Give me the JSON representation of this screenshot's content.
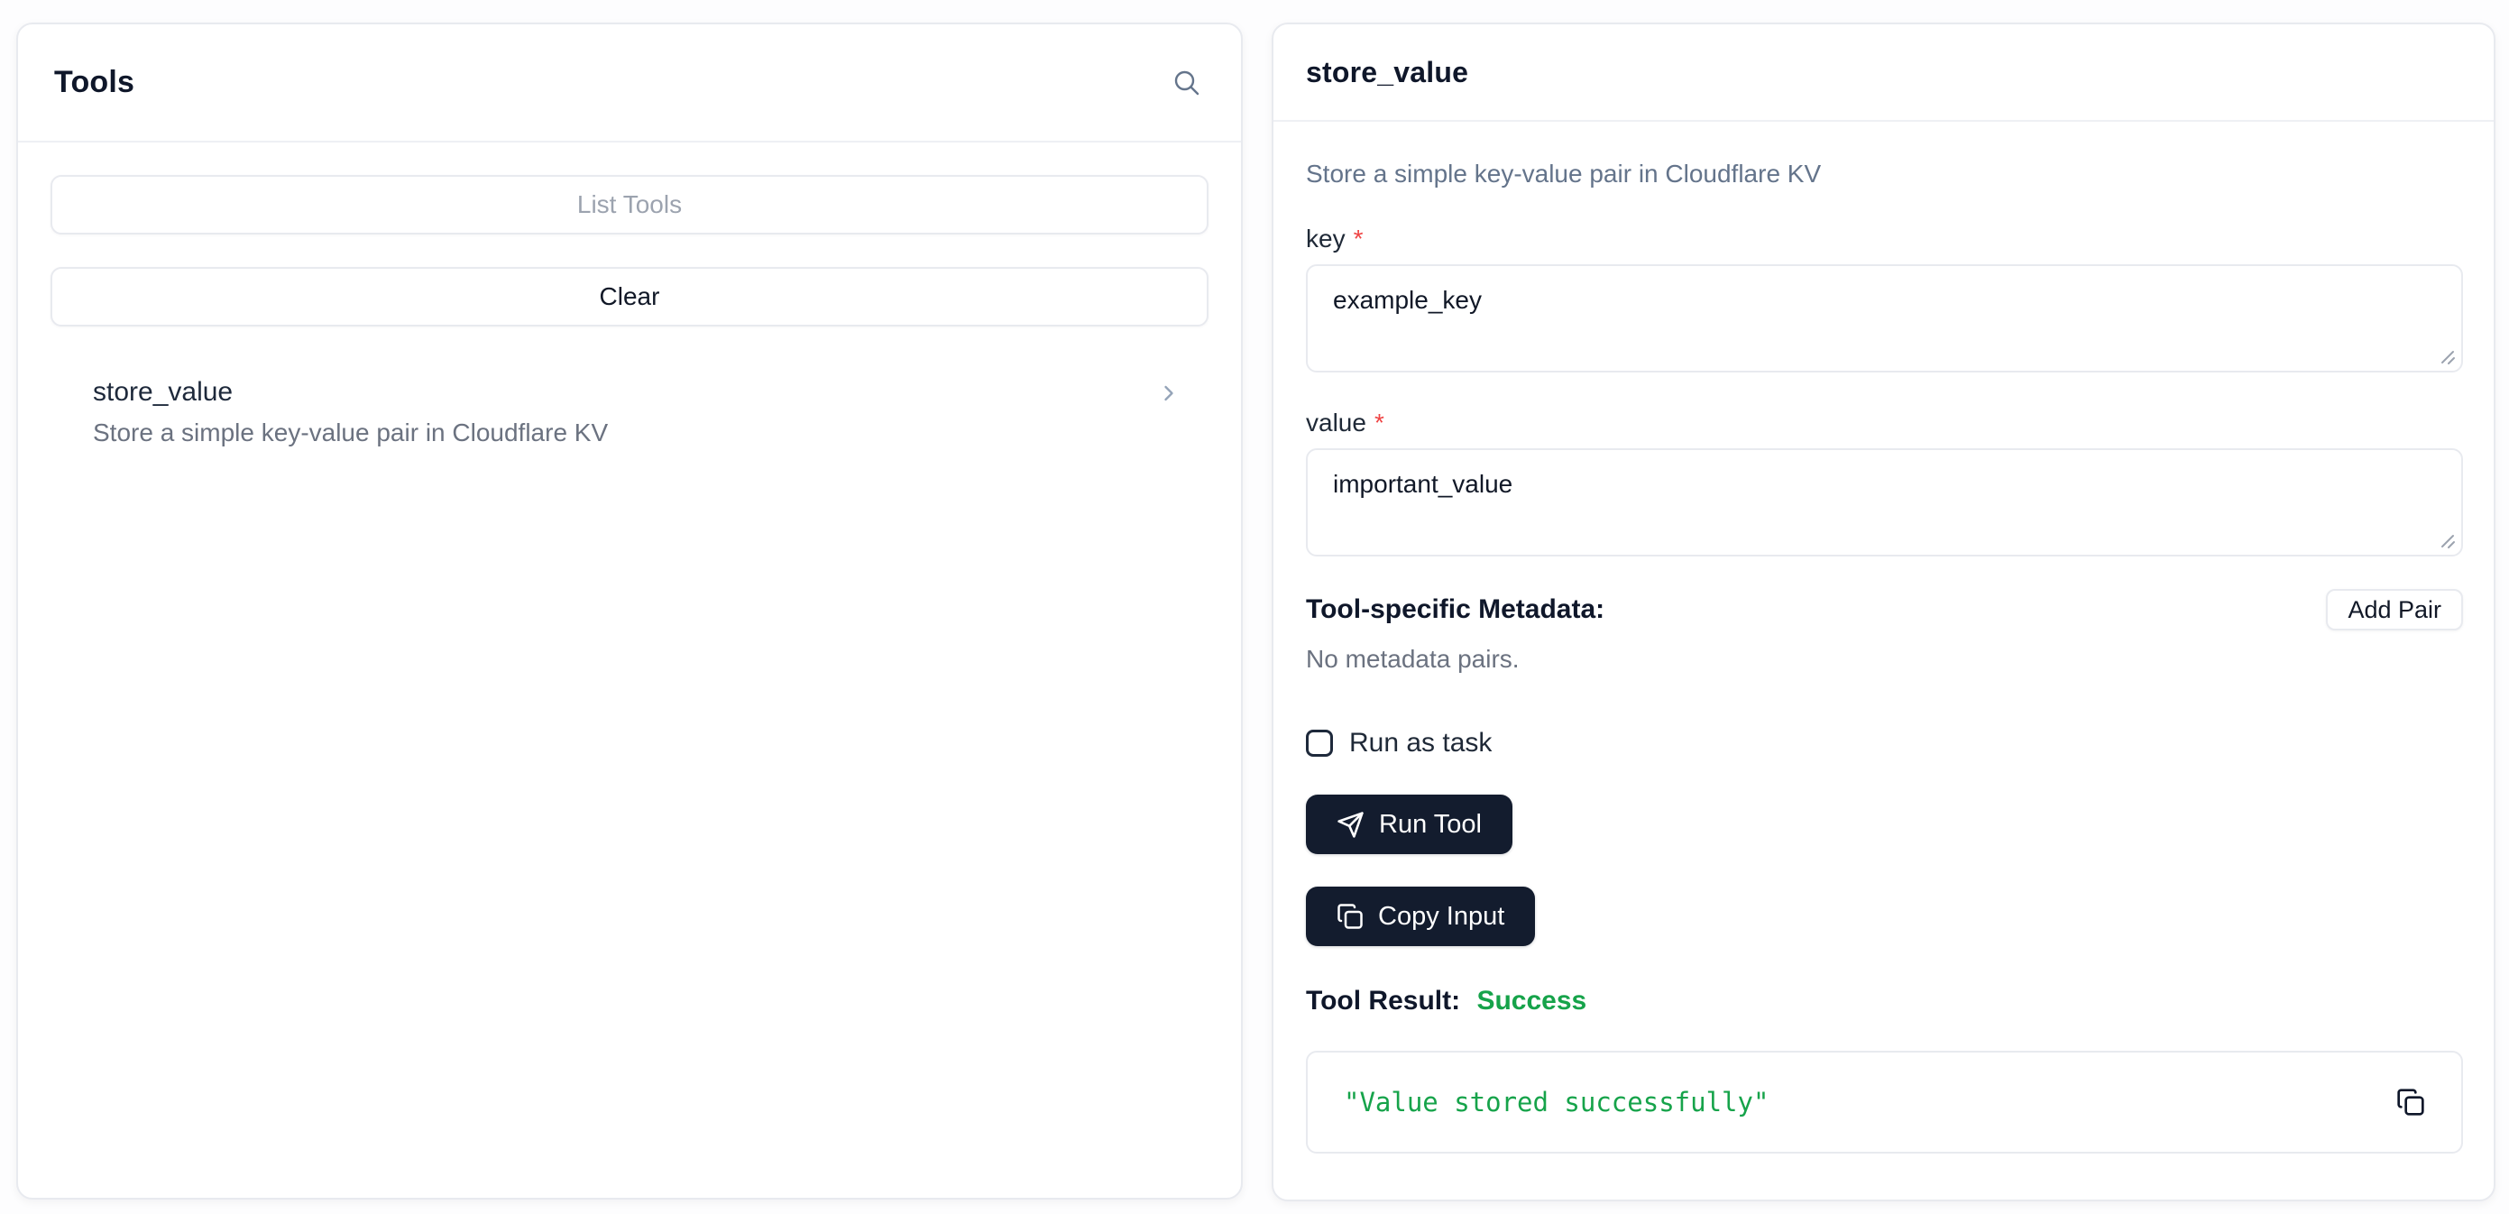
{
  "colors": {
    "accent_dark": "#131c2e",
    "success_green": "#16a34a",
    "required_red": "#ef4444",
    "panel_border": "#e8eaef",
    "muted_text": "#6b7280"
  },
  "icons": {
    "search": "magnifying-glass",
    "chevron_right": "angle-bracket-right",
    "send": "paper-plane",
    "copy": "overlapping-squares",
    "resize_grip": "diagonal-lines"
  },
  "tools_panel": {
    "title": "Tools",
    "list_tools_button": "List Tools",
    "clear_button": "Clear",
    "tools": [
      {
        "name": "store_value",
        "description": "Store a simple key-value pair in Cloudflare KV"
      }
    ]
  },
  "detail_panel": {
    "title": "store_value",
    "description": "Store a simple key-value pair in Cloudflare KV",
    "fields": [
      {
        "label": "key",
        "required_marker": "*",
        "value": "example_key"
      },
      {
        "label": "value",
        "required_marker": "*",
        "value": "important_value"
      }
    ],
    "metadata": {
      "heading": "Tool-specific Metadata:",
      "add_pair_button": "Add Pair",
      "empty_text": "No metadata pairs."
    },
    "run_as_task": {
      "label": "Run as task",
      "checked": false
    },
    "run_tool_button": "Run Tool",
    "copy_input_button": "Copy Input",
    "result": {
      "heading": "Tool Result:",
      "status": "Success",
      "output": "\"Value stored successfully\""
    }
  }
}
